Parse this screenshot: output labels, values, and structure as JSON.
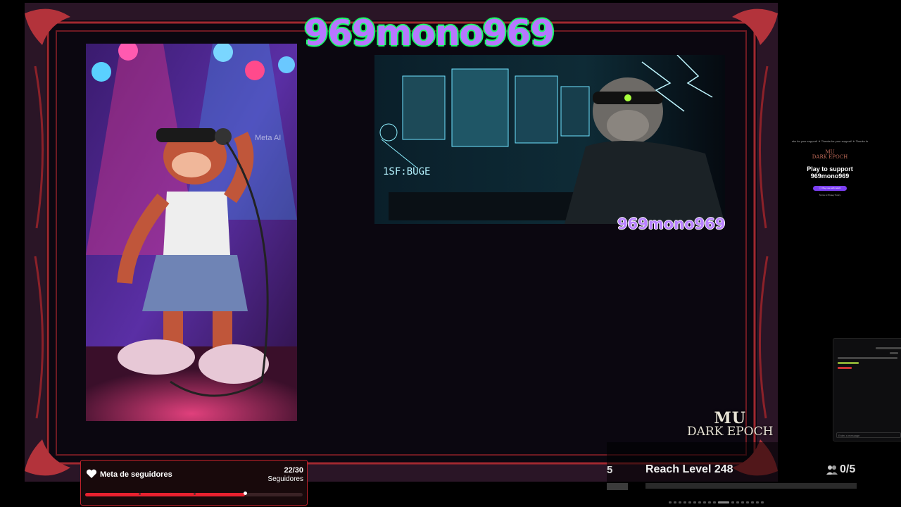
{
  "stream": {
    "title": "969mono969",
    "overlay_name": "969mono969",
    "image_watermark": "Meta AI",
    "image_right_text": "1SF:BUGE"
  },
  "side_widget": {
    "ticker": "nks for your support! ✦ Thanks for your support! ✦ Thanks fo",
    "logo_line1": "MU",
    "logo_line2": "DARK EPOCH",
    "support_line1": "Play to support",
    "support_line2": "969mono969",
    "button_label": "ⓒ Play now with twitch",
    "small_text": "Terms & Privacy Policy"
  },
  "chat": {
    "input_placeholder": "Enter a message"
  },
  "game_logo": {
    "line1": "MU",
    "line2": "DARK EPOCH"
  },
  "follower_goal": {
    "title": "Meta de seguidores",
    "count": "22/30",
    "unit": "Seguidores",
    "progress": 0.7333,
    "accent": "#e8212f"
  },
  "quest": {
    "left_fragment": "5",
    "title": "Reach Level 248",
    "progress": "0/5"
  },
  "colors": {
    "frame": "#a0282f",
    "title_fill": "#b777ff",
    "title_outline": "#1cff6a"
  }
}
